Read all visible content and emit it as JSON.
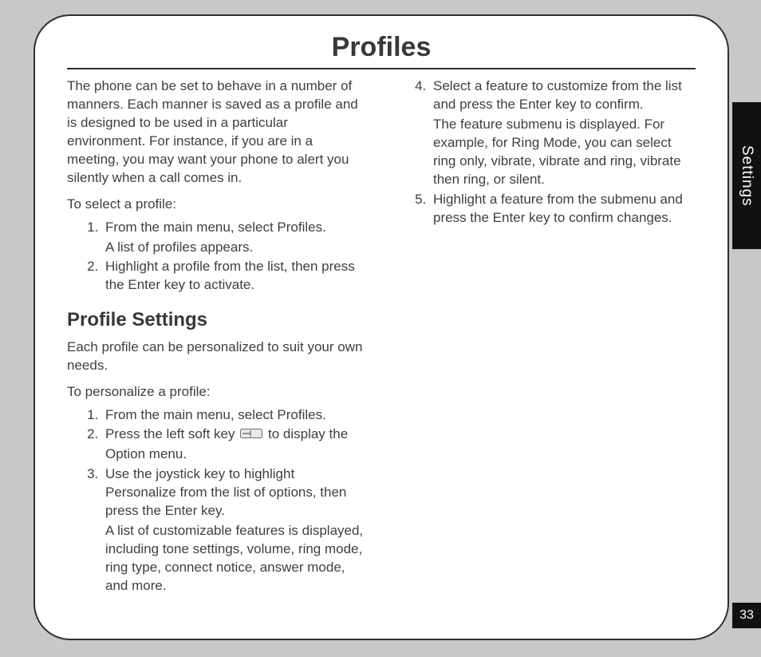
{
  "title": "Profiles",
  "side_tab": "Settings",
  "page_number": "33",
  "intro": "The phone can be set to behave in a number of manners. Each manner is saved as a profile and is designed to be used in a particular environment. For instance, if you are in a meeting, you may want your phone to alert you silently when a call comes in.",
  "select_lead": "To select a profile:",
  "select_steps": [
    {
      "text": "From the main menu, select Profiles.",
      "sub": "A list of profiles appears."
    },
    {
      "text": "Highlight a profile from the list, then press the Enter key to activate."
    }
  ],
  "section_heading": "Profile Settings",
  "section_intro": "Each profile can be personalized to suit your own needs.",
  "personalize_lead": "To personalize a profile:",
  "personalize_steps_col1": [
    {
      "text": "From the main menu, select Profiles."
    },
    {
      "text_before": "Press the left soft key ",
      "has_icon": true,
      "text_after": " to display the Option menu."
    },
    {
      "text": "Use the joystick key to highlight Personalize from the list of options, then press the Enter key.",
      "sub": "A list of customizable features is displayed, including tone settings, volume, ring mode, ring type, connect notice, answer mode, and more."
    }
  ],
  "personalize_steps_col2": [
    {
      "text": "Select a feature to customize from the list and press the Enter key to confirm.",
      "sub": "The feature submenu is displayed. For example, for Ring Mode, you can select ring only, vibrate, vibrate and ring, vibrate then ring, or silent."
    },
    {
      "text": "Highlight a feature from the submenu and press the Enter key to confirm changes."
    }
  ],
  "icons": {
    "softkey": "soft-key-icon"
  }
}
